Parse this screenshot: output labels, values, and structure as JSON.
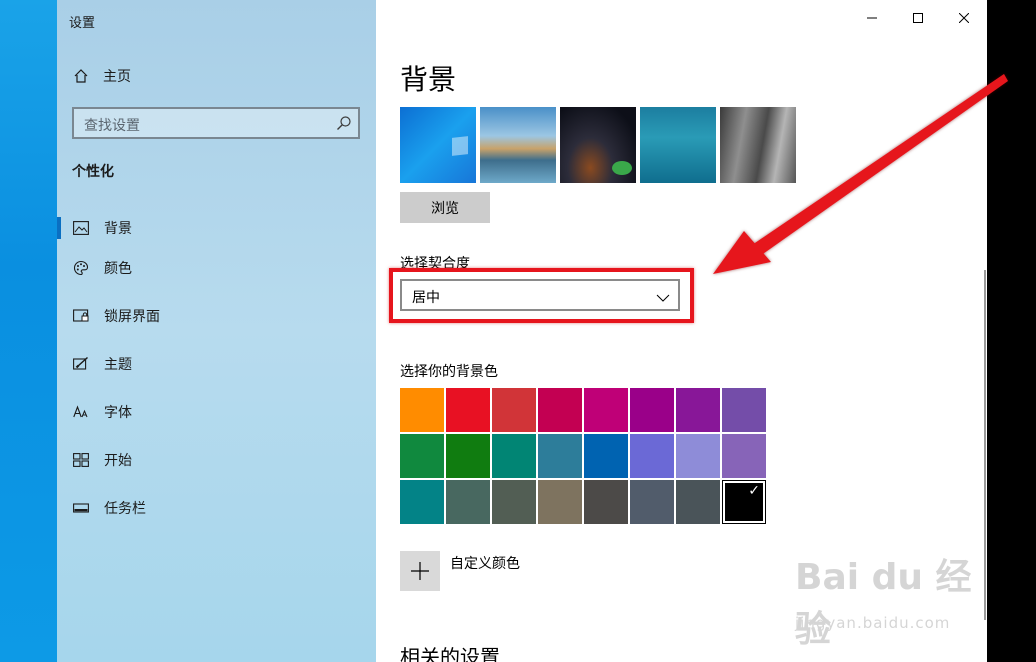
{
  "window": {
    "title": "设置"
  },
  "sidebar": {
    "home_label": "主页",
    "search_placeholder": "查找设置",
    "section_title": "个性化",
    "items": [
      {
        "label": "背景",
        "icon": "picture-icon",
        "active": true
      },
      {
        "label": "颜色",
        "icon": "palette-icon",
        "active": false
      },
      {
        "label": "锁屏界面",
        "icon": "lock-screen-icon",
        "active": false
      },
      {
        "label": "主题",
        "icon": "theme-brush-icon",
        "active": false
      },
      {
        "label": "字体",
        "icon": "font-icon",
        "active": false
      },
      {
        "label": "开始",
        "icon": "start-grid-icon",
        "active": false
      },
      {
        "label": "任务栏",
        "icon": "taskbar-icon",
        "active": false
      }
    ]
  },
  "main": {
    "page_title": "背景",
    "browse_label": "浏览",
    "fit_label": "选择契合度",
    "fit_value": "居中",
    "color_label": "选择你的背景色",
    "custom_color_label": "自定义颜色",
    "related_title": "相关的设置"
  },
  "swatches": [
    "#ff8c00",
    "#e81123",
    "#d13438",
    "#c30052",
    "#bf0077",
    "#9a0089",
    "#881798",
    "#744da9",
    "#10893e",
    "#107c10",
    "#018574",
    "#2d7d9a",
    "#0063b1",
    "#6b69d6",
    "#8e8cd8",
    "#8764b8",
    "#038387",
    "#486860",
    "#525e54",
    "#7e735f",
    "#4c4a48",
    "#515c6b",
    "#4a5459",
    "#000000"
  ],
  "selected_swatch": 23,
  "watermark": {
    "main": "Bai du 经验",
    "sub": "jingyan.baidu.com"
  },
  "colors": {
    "accent": "#0a6fc2",
    "annotation_red": "#e6151d"
  }
}
